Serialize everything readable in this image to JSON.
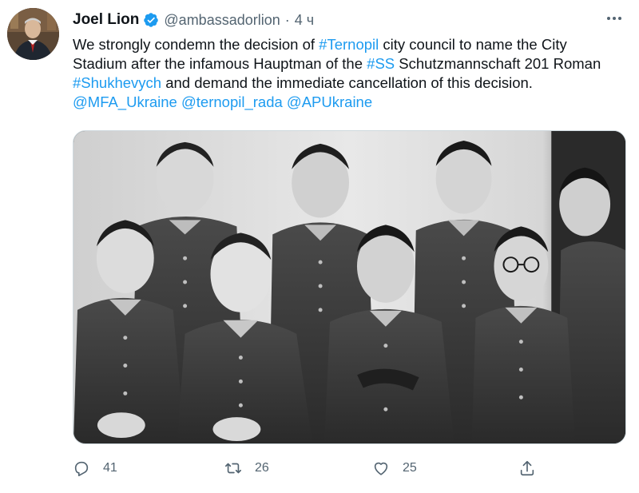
{
  "tweet": {
    "author": {
      "display_name": "Joel Lion",
      "handle": "@ambassadorlion",
      "verified": true,
      "avatar_icon": "avatar"
    },
    "separator": "·",
    "time": "4 ч",
    "text_parts": {
      "p1": "We strongly condemn the decision of ",
      "h1": "#Ternopil",
      "p2": " city council to name the City Stadium after the infamous Hauptman of the ",
      "h2": "#SS",
      "p3": " Schutzmannschaft 201 Roman ",
      "h3": "#Shukhevych",
      "p4": " and demand the immediate cancellation of this decision. ",
      "m1": "@MFA_Ukraine",
      "sp1": " ",
      "m2": "@ternopil_rada",
      "sp2": " ",
      "m3": "@APUkraine"
    },
    "media": {
      "kind": "black-and-white photograph of eight men in military uniform"
    },
    "actions": {
      "replies": "41",
      "retweets": "26",
      "likes": "25"
    }
  },
  "colors": {
    "link": "#1d9bf0",
    "secondary_text": "#536471",
    "primary_text": "#0f1419",
    "verified_badge": "#1d9bf0"
  }
}
